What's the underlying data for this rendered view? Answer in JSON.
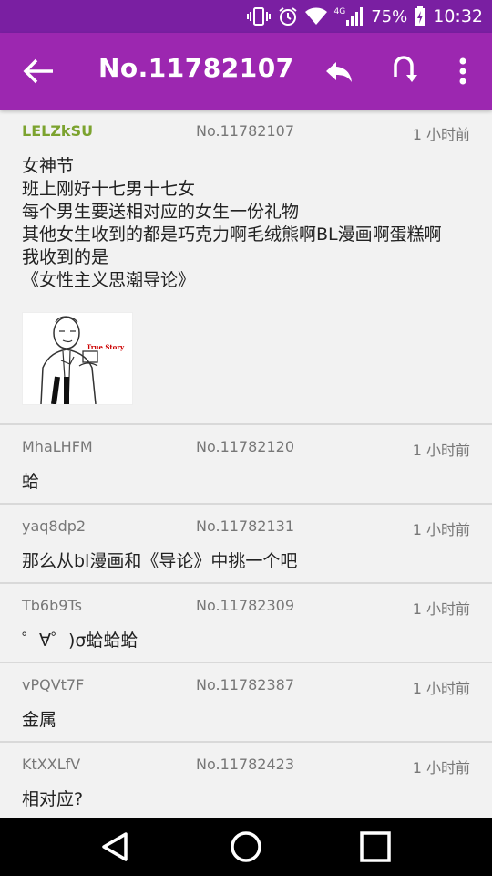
{
  "status": {
    "battery": "75%",
    "time": "10:32",
    "network": "4G"
  },
  "appbar": {
    "title": "No.11782107"
  },
  "posts": [
    {
      "uid": "LELZkSU",
      "no": "No.11782107",
      "time": "1 小时前",
      "content": "女神节\n班上刚好十七男十七女\n每个男生要送相对应的女生一份礼物\n其他女生收到的都是巧克力啊毛绒熊啊BL漫画啊蛋糕啊\n我收到的是\n《女性主义思潮导论》",
      "image_caption": "True Story"
    },
    {
      "uid": "MhaLHFM",
      "no": "No.11782120",
      "time": "1 小时前",
      "content": "蛤"
    },
    {
      "uid": "yaq8dp2",
      "no": "No.11782131",
      "time": "1 小时前",
      "content": "那么从bl漫画和《导论》中挑一个吧"
    },
    {
      "uid": "Tb6b9Ts",
      "no": "No.11782309",
      "time": "1 小时前",
      "content": "゜∀゜)σ蛤蛤蛤"
    },
    {
      "uid": "vPQVt7F",
      "no": "No.11782387",
      "time": "1 小时前",
      "content": "金属"
    },
    {
      "uid": "KtXXLfV",
      "no": "No.11782423",
      "time": "1 小时前",
      "content": "相对应?"
    }
  ],
  "icons": {
    "back": "arrow-left-icon",
    "reply": "reply-icon",
    "jump": "jump-icon",
    "more": "more-vert-icon",
    "nav_back": "triangle-back-icon",
    "nav_home": "circle-home-icon",
    "nav_recent": "square-recent-icon"
  },
  "colors": {
    "statusbar": "#7a1fa2",
    "appbar": "#9c27b0",
    "op_uid": "#7ca32f"
  }
}
